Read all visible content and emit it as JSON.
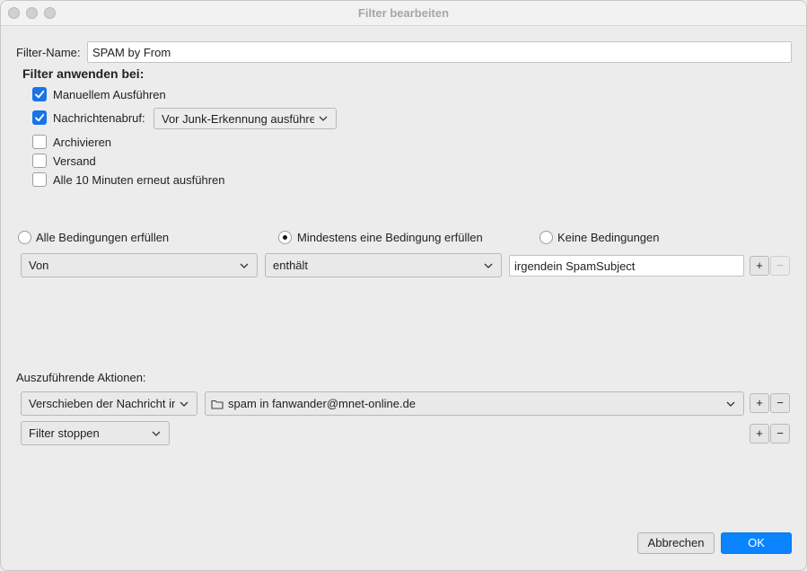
{
  "window": {
    "title": "Filter bearbeiten"
  },
  "filter_name": {
    "label": "Filter-Name:",
    "value": "SPAM by From"
  },
  "apply": {
    "heading": "Filter anwenden bei:",
    "manual": {
      "label": "Manuellem Ausführen",
      "checked": true
    },
    "fetch": {
      "label": "Nachrichtenabruf:",
      "checked": true,
      "mode": "Vor Junk-Erkennung ausführen"
    },
    "archive": {
      "label": "Archivieren",
      "checked": false
    },
    "send": {
      "label": "Versand",
      "checked": false
    },
    "periodic": {
      "label": "Alle 10 Minuten erneut ausführen",
      "checked": false
    }
  },
  "match": {
    "all": "Alle Bedingungen erfüllen",
    "any": "Mindestens eine Bedingung erfüllen",
    "none": "Keine Bedingungen",
    "selected": "any"
  },
  "condition": {
    "field": "Von",
    "operator": "enthält",
    "value": "irgendein SpamSubject",
    "add": "+",
    "remove": "−"
  },
  "actions": {
    "label": "Auszuführende Aktionen:",
    "rows": [
      {
        "action": "Verschieben der Nachricht in:",
        "target": "spam in fanwander@mnet-online.de",
        "add": "+",
        "remove": "−"
      },
      {
        "action": "Filter stoppen",
        "add": "+",
        "remove": "−"
      }
    ]
  },
  "buttons": {
    "cancel": "Abbrechen",
    "ok": "OK"
  },
  "colors": {
    "accent": "#0a84ff",
    "checkbox": "#1a73e8",
    "background": "#ececec"
  }
}
